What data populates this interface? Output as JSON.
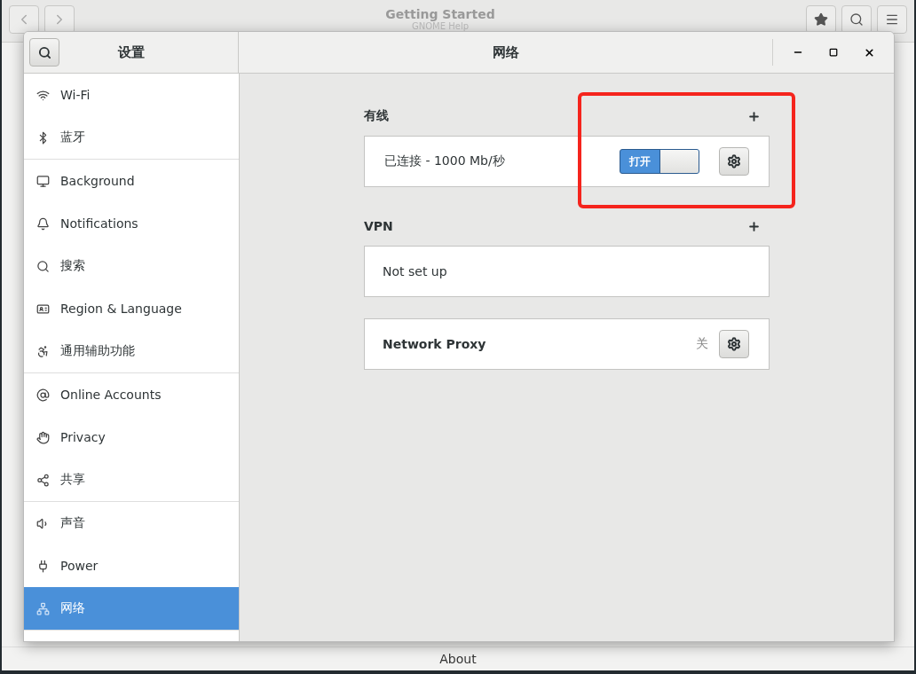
{
  "back_window": {
    "title": "Getting Started",
    "subtitle": "GNOME Help",
    "footer": "About"
  },
  "window": {
    "sidebar_title": "设置",
    "title": "网络"
  },
  "sidebar": {
    "groups": [
      [
        {
          "label": "Wi-Fi",
          "selected": false
        },
        {
          "label": "蓝牙",
          "selected": false
        }
      ],
      [
        {
          "label": "Background",
          "selected": false
        },
        {
          "label": "Notifications",
          "selected": false
        },
        {
          "label": "搜索",
          "selected": false
        },
        {
          "label": "Region & Language",
          "selected": false
        },
        {
          "label": "通用辅助功能",
          "selected": false
        }
      ],
      [
        {
          "label": "Online Accounts",
          "selected": false
        },
        {
          "label": "Privacy",
          "selected": false
        },
        {
          "label": "共享",
          "selected": false
        }
      ],
      [
        {
          "label": "声音",
          "selected": false
        },
        {
          "label": "Power",
          "selected": false
        },
        {
          "label": "网络",
          "selected": true
        }
      ]
    ]
  },
  "wired": {
    "heading": "有线",
    "status": "已连接 - 1000 Mb/秒",
    "switch": {
      "label": "打开",
      "on": true
    }
  },
  "vpn": {
    "heading": "VPN",
    "status": "Not set up"
  },
  "proxy": {
    "label": "Network Proxy",
    "status": "关"
  }
}
